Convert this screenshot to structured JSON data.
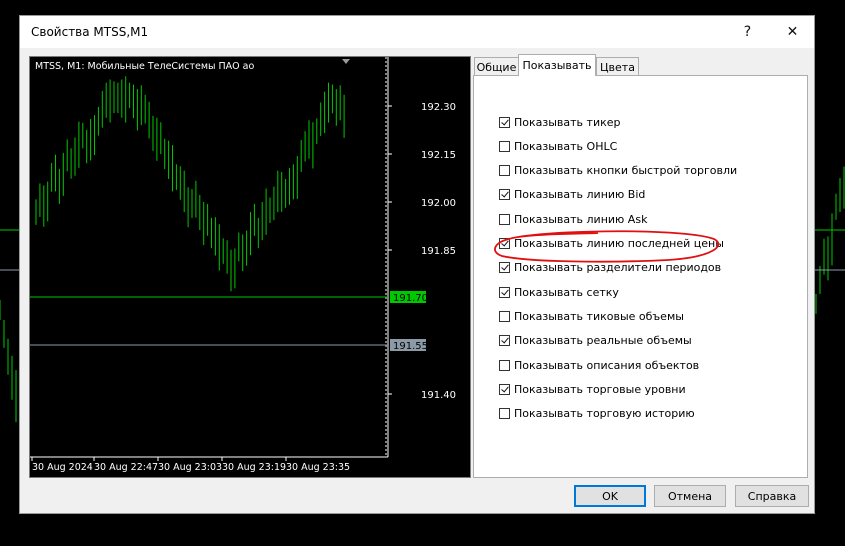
{
  "window": {
    "title": "Свойства MTSS,M1",
    "help_label": "?",
    "close_label": "✕"
  },
  "preview": {
    "header": "MTSS, M1:  Мобильные ТелеСистемы ПАО ао",
    "price_labels": [
      "192.30",
      "192.15",
      "192.00",
      "191.85",
      "191.40"
    ],
    "bid_label": "191.70",
    "last_label": "191.55",
    "time_labels": [
      "30 Aug 2024",
      "30 Aug 22:47",
      "30 Aug 23:03",
      "30 Aug 23:19",
      "30 Aug 23:35"
    ],
    "colors": {
      "background": "#000000",
      "candles": "#00c800",
      "bid_line": "#00c800",
      "last_line": "#8c9aa8"
    }
  },
  "tabs": [
    "Общие",
    "Показывать",
    "Цвета"
  ],
  "active_tab": "Показывать",
  "options": [
    {
      "label": "Показывать тикер",
      "checked": true
    },
    {
      "label": "Показывать OHLC",
      "checked": false
    },
    {
      "label": "Показывать кнопки быстрой торговли",
      "checked": false
    },
    {
      "label": "Показывать линию Bid",
      "checked": true
    },
    {
      "label": "Показывать линию Ask",
      "checked": false
    },
    {
      "label": "Показывать линию последней цены",
      "checked": true
    },
    {
      "label": "Показывать разделители периодов",
      "checked": true
    },
    {
      "label": "Показывать сетку",
      "checked": true
    },
    {
      "label": "Показывать тиковые объемы",
      "checked": false
    },
    {
      "label": "Показывать реальные объемы",
      "checked": true
    },
    {
      "label": "Показывать описания объектов",
      "checked": false
    },
    {
      "label": "Показывать торговые уровни",
      "checked": true
    },
    {
      "label": "Показывать торговую историю",
      "checked": false
    }
  ],
  "buttons": {
    "ok": "OK",
    "cancel": "Отмена",
    "help": "Справка"
  },
  "annotation": {
    "color": "#e01010"
  }
}
